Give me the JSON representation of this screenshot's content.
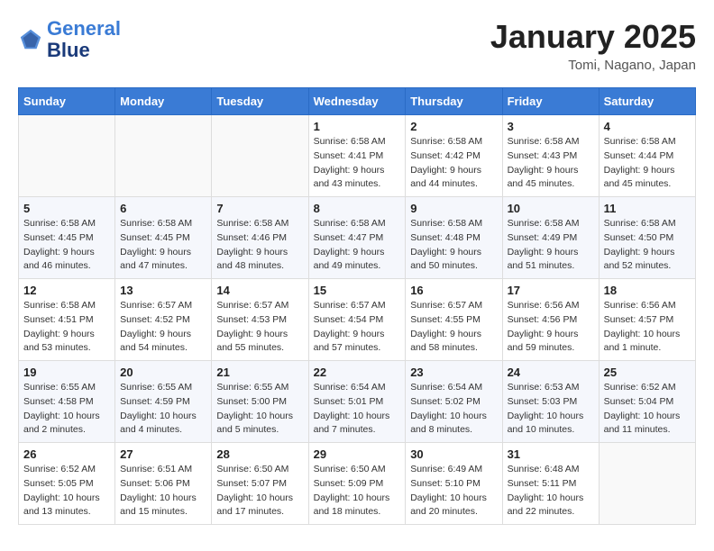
{
  "header": {
    "logo_line1": "General",
    "logo_line2": "Blue",
    "month": "January 2025",
    "location": "Tomi, Nagano, Japan"
  },
  "days_of_week": [
    "Sunday",
    "Monday",
    "Tuesday",
    "Wednesday",
    "Thursday",
    "Friday",
    "Saturday"
  ],
  "weeks": [
    [
      {
        "day": "",
        "info": ""
      },
      {
        "day": "",
        "info": ""
      },
      {
        "day": "",
        "info": ""
      },
      {
        "day": "1",
        "info": "Sunrise: 6:58 AM\nSunset: 4:41 PM\nDaylight: 9 hours\nand 43 minutes."
      },
      {
        "day": "2",
        "info": "Sunrise: 6:58 AM\nSunset: 4:42 PM\nDaylight: 9 hours\nand 44 minutes."
      },
      {
        "day": "3",
        "info": "Sunrise: 6:58 AM\nSunset: 4:43 PM\nDaylight: 9 hours\nand 45 minutes."
      },
      {
        "day": "4",
        "info": "Sunrise: 6:58 AM\nSunset: 4:44 PM\nDaylight: 9 hours\nand 45 minutes."
      }
    ],
    [
      {
        "day": "5",
        "info": "Sunrise: 6:58 AM\nSunset: 4:45 PM\nDaylight: 9 hours\nand 46 minutes."
      },
      {
        "day": "6",
        "info": "Sunrise: 6:58 AM\nSunset: 4:45 PM\nDaylight: 9 hours\nand 47 minutes."
      },
      {
        "day": "7",
        "info": "Sunrise: 6:58 AM\nSunset: 4:46 PM\nDaylight: 9 hours\nand 48 minutes."
      },
      {
        "day": "8",
        "info": "Sunrise: 6:58 AM\nSunset: 4:47 PM\nDaylight: 9 hours\nand 49 minutes."
      },
      {
        "day": "9",
        "info": "Sunrise: 6:58 AM\nSunset: 4:48 PM\nDaylight: 9 hours\nand 50 minutes."
      },
      {
        "day": "10",
        "info": "Sunrise: 6:58 AM\nSunset: 4:49 PM\nDaylight: 9 hours\nand 51 minutes."
      },
      {
        "day": "11",
        "info": "Sunrise: 6:58 AM\nSunset: 4:50 PM\nDaylight: 9 hours\nand 52 minutes."
      }
    ],
    [
      {
        "day": "12",
        "info": "Sunrise: 6:58 AM\nSunset: 4:51 PM\nDaylight: 9 hours\nand 53 minutes."
      },
      {
        "day": "13",
        "info": "Sunrise: 6:57 AM\nSunset: 4:52 PM\nDaylight: 9 hours\nand 54 minutes."
      },
      {
        "day": "14",
        "info": "Sunrise: 6:57 AM\nSunset: 4:53 PM\nDaylight: 9 hours\nand 55 minutes."
      },
      {
        "day": "15",
        "info": "Sunrise: 6:57 AM\nSunset: 4:54 PM\nDaylight: 9 hours\nand 57 minutes."
      },
      {
        "day": "16",
        "info": "Sunrise: 6:57 AM\nSunset: 4:55 PM\nDaylight: 9 hours\nand 58 minutes."
      },
      {
        "day": "17",
        "info": "Sunrise: 6:56 AM\nSunset: 4:56 PM\nDaylight: 9 hours\nand 59 minutes."
      },
      {
        "day": "18",
        "info": "Sunrise: 6:56 AM\nSunset: 4:57 PM\nDaylight: 10 hours\nand 1 minute."
      }
    ],
    [
      {
        "day": "19",
        "info": "Sunrise: 6:55 AM\nSunset: 4:58 PM\nDaylight: 10 hours\nand 2 minutes."
      },
      {
        "day": "20",
        "info": "Sunrise: 6:55 AM\nSunset: 4:59 PM\nDaylight: 10 hours\nand 4 minutes."
      },
      {
        "day": "21",
        "info": "Sunrise: 6:55 AM\nSunset: 5:00 PM\nDaylight: 10 hours\nand 5 minutes."
      },
      {
        "day": "22",
        "info": "Sunrise: 6:54 AM\nSunset: 5:01 PM\nDaylight: 10 hours\nand 7 minutes."
      },
      {
        "day": "23",
        "info": "Sunrise: 6:54 AM\nSunset: 5:02 PM\nDaylight: 10 hours\nand 8 minutes."
      },
      {
        "day": "24",
        "info": "Sunrise: 6:53 AM\nSunset: 5:03 PM\nDaylight: 10 hours\nand 10 minutes."
      },
      {
        "day": "25",
        "info": "Sunrise: 6:52 AM\nSunset: 5:04 PM\nDaylight: 10 hours\nand 11 minutes."
      }
    ],
    [
      {
        "day": "26",
        "info": "Sunrise: 6:52 AM\nSunset: 5:05 PM\nDaylight: 10 hours\nand 13 minutes."
      },
      {
        "day": "27",
        "info": "Sunrise: 6:51 AM\nSunset: 5:06 PM\nDaylight: 10 hours\nand 15 minutes."
      },
      {
        "day": "28",
        "info": "Sunrise: 6:50 AM\nSunset: 5:07 PM\nDaylight: 10 hours\nand 17 minutes."
      },
      {
        "day": "29",
        "info": "Sunrise: 6:50 AM\nSunset: 5:09 PM\nDaylight: 10 hours\nand 18 minutes."
      },
      {
        "day": "30",
        "info": "Sunrise: 6:49 AM\nSunset: 5:10 PM\nDaylight: 10 hours\nand 20 minutes."
      },
      {
        "day": "31",
        "info": "Sunrise: 6:48 AM\nSunset: 5:11 PM\nDaylight: 10 hours\nand 22 minutes."
      },
      {
        "day": "",
        "info": ""
      }
    ]
  ]
}
